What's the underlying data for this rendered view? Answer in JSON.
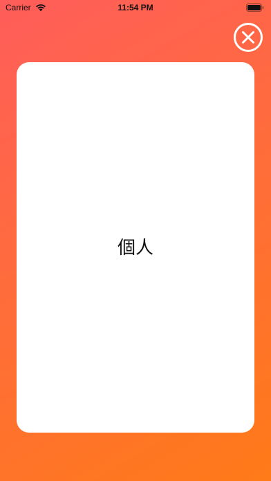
{
  "status_bar": {
    "carrier": "Carrier",
    "time": "11:54 PM",
    "icons": [
      "wifi-icon",
      "battery-icon"
    ]
  },
  "close_button": {
    "icon": "close-icon",
    "color": "#ffffff"
  },
  "card": {
    "word": "個人",
    "background": "#ffffff"
  },
  "colors": {
    "gradient_start": "#ff5d5a",
    "gradient_end": "#ff7a18",
    "text": "#111111"
  }
}
